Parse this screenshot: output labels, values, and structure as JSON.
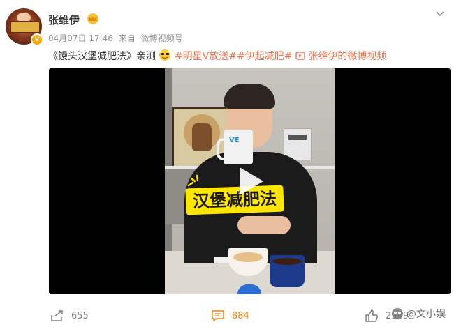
{
  "post": {
    "username": "张维伊",
    "time": "04月07日 17:46",
    "source_prefix": "来自",
    "source": "微博视频号",
    "text_prefix": "《馒头汉堡减肥法》亲测",
    "topics": [
      "#明星V放送#",
      "#伊起减肥#"
    ],
    "video_link": "张维伊的微博视频"
  },
  "video": {
    "caption": "汉堡减肥法",
    "mug_logo": "VE"
  },
  "actions": {
    "repost_count": "655",
    "comment_count": "884",
    "like_count": "2949"
  },
  "watermark": "@文小娱",
  "colors": {
    "topic": "#eb7350",
    "badge": "#f7a800",
    "caption_bg": "#ffe600"
  }
}
